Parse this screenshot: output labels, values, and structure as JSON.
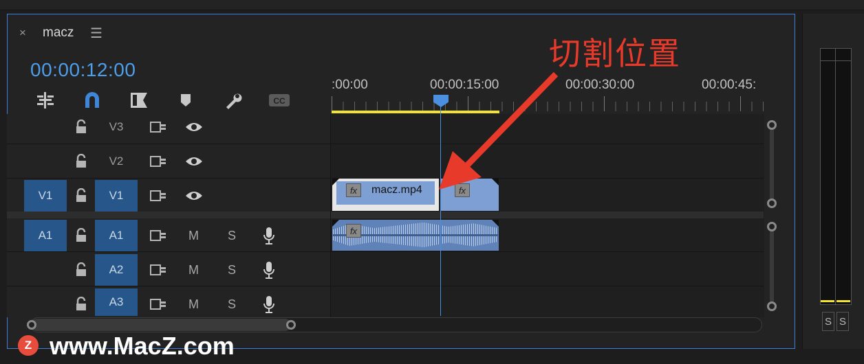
{
  "sequence": {
    "tab_close": "×",
    "title": "macz",
    "menu_glyph": "☰",
    "timecode": "00:00:12:00"
  },
  "toolbar": [
    "insert-snap-icon",
    "magnet-icon",
    "linked-selection-icon",
    "marker-icon",
    "wrench-icon",
    "captions-icon"
  ],
  "ruler": {
    "labels": [
      ":00:00",
      "00:00:15:00",
      "00:00:30:00",
      "00:00:45:"
    ]
  },
  "tracks": {
    "video": [
      {
        "name": "V3",
        "source": ""
      },
      {
        "name": "V2",
        "source": ""
      },
      {
        "name": "V1",
        "source": "V1"
      }
    ],
    "audio": [
      {
        "name": "A1",
        "source": "A1",
        "m": "M",
        "s": "S"
      },
      {
        "name": "A2",
        "source": "",
        "m": "M",
        "s": "S"
      },
      {
        "name": "A3",
        "source": "",
        "m": "M",
        "s": "S"
      }
    ]
  },
  "clips": {
    "video_name": "macz.mp4",
    "fx": "fx"
  },
  "annotation": {
    "text": "切割位置",
    "color": "#e83a2a"
  },
  "meters": {
    "solo_left": "S",
    "solo_right": "S"
  },
  "watermark": {
    "logo": "Z",
    "text": "www.MacZ.com"
  },
  "colors": {
    "accent": "#4a8fe0",
    "track_target": "#27578a",
    "clip": "#7d9fd3",
    "work_area": "#f2e233"
  }
}
